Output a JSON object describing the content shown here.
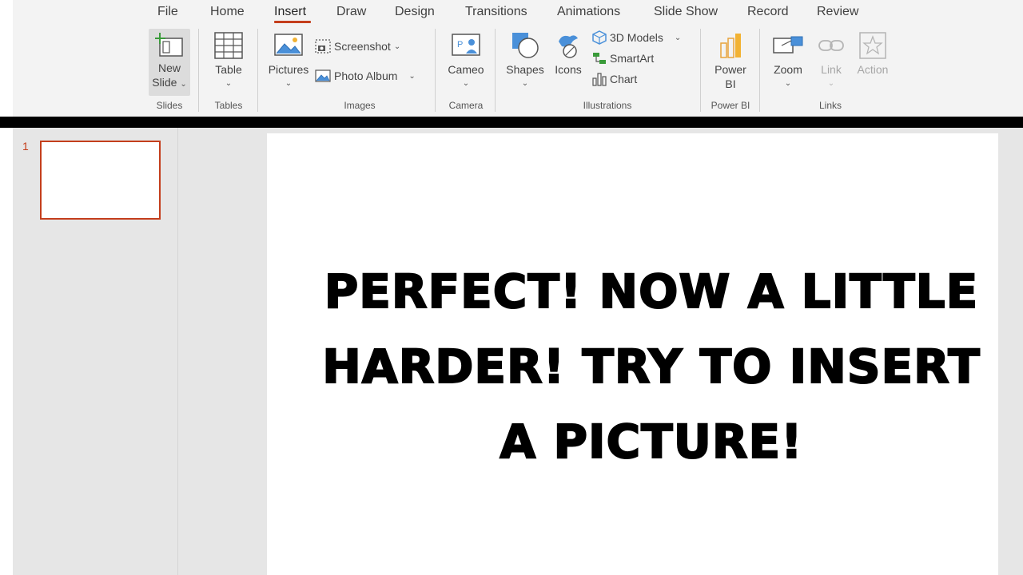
{
  "ribbon": {
    "tabs": [
      {
        "label": "File"
      },
      {
        "label": "Home"
      },
      {
        "label": "Insert"
      },
      {
        "label": "Draw"
      },
      {
        "label": "Design"
      },
      {
        "label": "Transitions"
      },
      {
        "label": "Animations"
      },
      {
        "label": "Slide Show"
      },
      {
        "label": "Record"
      },
      {
        "label": "Review"
      }
    ],
    "active_tab": "Insert",
    "accent_color": "#c43e1c",
    "groups": {
      "slides": {
        "label": "Slides",
        "new_slide_line1": "New",
        "new_slide_line2": "Slide"
      },
      "tables": {
        "label": "Tables",
        "table": "Table"
      },
      "images": {
        "label": "Images",
        "pictures": "Pictures",
        "screenshot": "Screenshot",
        "photo_album": "Photo Album"
      },
      "camera": {
        "label": "Camera",
        "cameo": "Cameo"
      },
      "illustrations": {
        "label": "Illustrations",
        "shapes": "Shapes",
        "icons": "Icons",
        "models_3d": "3D Models",
        "smartart": "SmartArt",
        "chart": "Chart"
      },
      "power_bi": {
        "label": "Power BI",
        "power_bi_line1": "Power",
        "power_bi_line2": "BI"
      },
      "links": {
        "label": "Links",
        "zoom": "Zoom",
        "link": "Link",
        "action": "Action"
      }
    }
  },
  "slides_panel": {
    "thumbnails": [
      {
        "number": "1"
      }
    ]
  },
  "slide": {
    "text_line1": "PERFECT! NOW A LITTLE",
    "text_line2": "HARDER! TRY TO INSERT",
    "text_line3": "A PICTURE!"
  }
}
